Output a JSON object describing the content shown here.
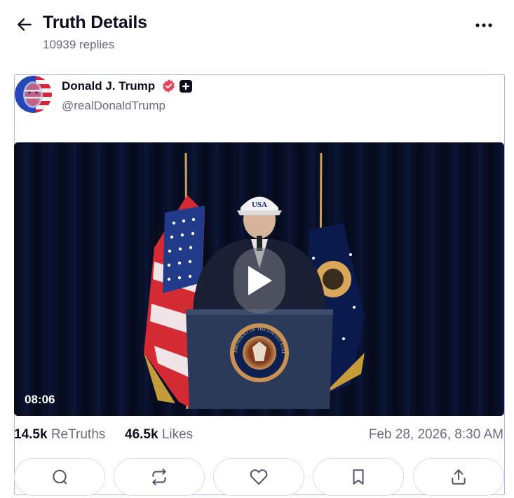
{
  "header": {
    "title": "Truth Details",
    "replies": "10939 replies"
  },
  "post": {
    "author_name": "Donald J. Trump",
    "handle": "@realDonaldTrump",
    "video": {
      "duration": "08:06",
      "cap_text": "USA",
      "seal_text": "PRESIDENT OF THE UNITED STATES"
    },
    "stats": {
      "retruths_count": "14.5k",
      "retruths_label": "ReTruths",
      "likes_count": "46.5k",
      "likes_label": "Likes",
      "timestamp": "Feb 28, 2026, 8:30 AM"
    }
  },
  "colors": {
    "accent_border": "#aab4f5",
    "verified": "#e9445a",
    "text_primary": "#0f0e1f",
    "text_secondary": "#6b6a80"
  },
  "icons": {
    "back": "arrow-left-icon",
    "more": "more-horizontal-icon",
    "verified": "verified-badge-icon",
    "plus": "plus-badge-icon",
    "play": "play-icon",
    "reply": "comment-icon",
    "retruth": "repost-icon",
    "like": "heart-icon",
    "bookmark": "bookmark-icon",
    "share": "share-icon"
  }
}
